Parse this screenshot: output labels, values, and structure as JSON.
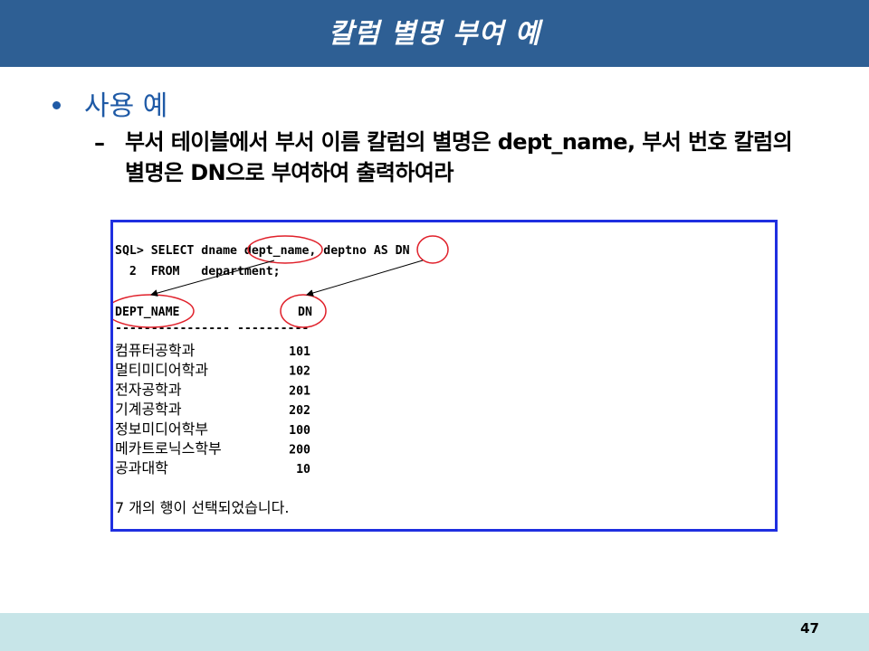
{
  "slide": {
    "title": "칼럼 별명 부여 예",
    "bullet": "사용 예",
    "dash": "–",
    "subtext": "부서 테이블에서 부서 이름 칼럼의 별명은 dept_name, 부서 번호 칼럼의 별명은 DN으로 부여하여 출력하여라",
    "page_number": "47"
  },
  "console": {
    "line1_prompt": "SQL> SELECT dname ",
    "line1_alias1": "dept_name",
    "line1_mid": ",   deptno  AS ",
    "line1_alias2": "DN",
    "line2": "  2  FROM   department;",
    "header_col1": "DEPT_NAME",
    "header_col2": "DN",
    "separator": "---------------- ----------",
    "rows": [
      {
        "name": "컴퓨터공학과",
        "dn": "101"
      },
      {
        "name": "멀티미디어학과",
        "dn": "102"
      },
      {
        "name": "전자공학과",
        "dn": "201"
      },
      {
        "name": "기계공학과",
        "dn": "202"
      },
      {
        "name": "정보미디어학부",
        "dn": "100"
      },
      {
        "name": "메카트로닉스학부",
        "dn": "200"
      },
      {
        "name": "공과대학",
        "dn": "10"
      }
    ],
    "footer": "7 개의 행이 선택되었습니다."
  },
  "colors": {
    "title_bar": "#2e5f94",
    "bullet": "#1f5aa6",
    "console_border": "#1f2fe0",
    "annotation": "#e0202a",
    "footer_band": "#c7e5e8"
  }
}
